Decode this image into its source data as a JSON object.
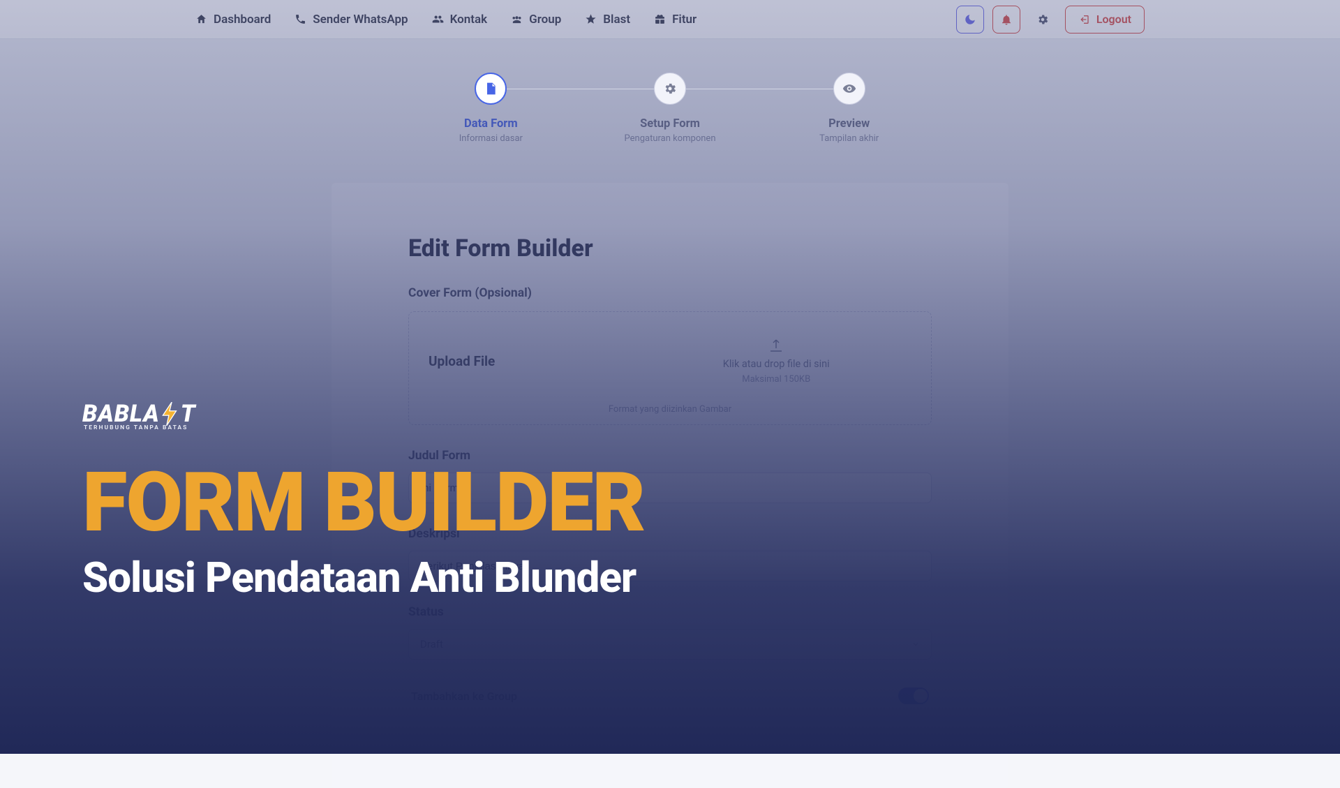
{
  "nav": {
    "items": [
      {
        "label": "Dashboard"
      },
      {
        "label": "Sender WhatsApp"
      },
      {
        "label": "Kontak"
      },
      {
        "label": "Group"
      },
      {
        "label": "Blast"
      },
      {
        "label": "Fitur"
      }
    ],
    "logout": "Logout"
  },
  "stepper": {
    "steps": [
      {
        "title": "Data Form",
        "sub": "Informasi dasar"
      },
      {
        "title": "Setup Form",
        "sub": "Pengaturan komponen"
      },
      {
        "title": "Preview",
        "sub": "Tampilan akhir"
      }
    ]
  },
  "card": {
    "title": "Edit Form Builder",
    "cover_label": "Cover Form (Opsional)",
    "upload_label": "Upload File",
    "upload_hint": "Klik atau drop file di sini",
    "upload_max": "Maksimal 150KB",
    "upload_format": "Format yang diizinkan Gambar",
    "judul_label": "Judul Form",
    "judul_value": "Ini Form",
    "deskripsi_label": "Deskripsi",
    "deskripsi_value": "Berikut Penjelasannya",
    "status_label": "Status",
    "status_value": "Draft",
    "group_toggle_label": "Tambahkan ke Group"
  },
  "hero": {
    "brand": {
      "pre": "BABLA",
      "post": "T",
      "tagline": "TERHUBUNG TANPA BATAS"
    },
    "title": "FORM BUILDER",
    "subtitle": "Solusi Pendataan Anti Blunder"
  },
  "colors": {
    "accent": "#4765e6",
    "danger": "#d9534f",
    "hero_title": "#eea52f"
  }
}
